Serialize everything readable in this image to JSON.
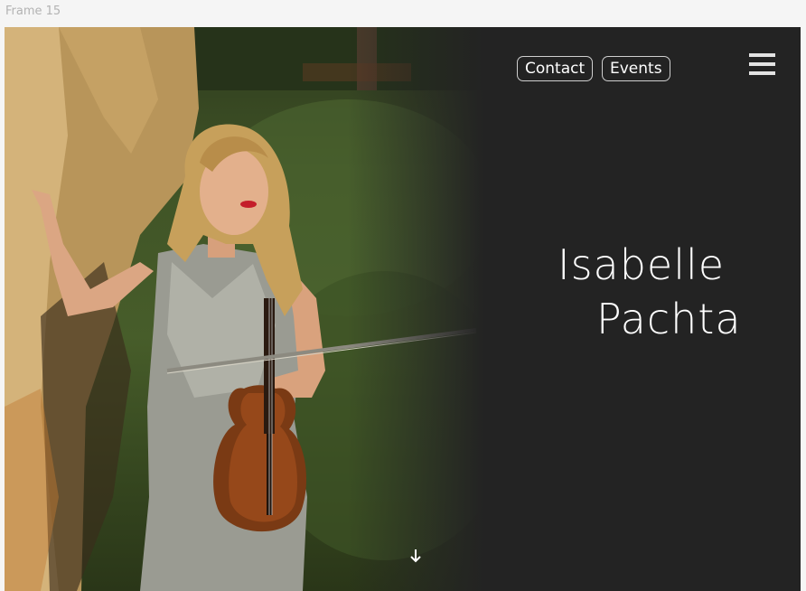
{
  "frame": {
    "label": "Frame 15"
  },
  "nav": {
    "contact_label": "Contact",
    "events_label": "Events",
    "menu_icon": "hamburger-menu-icon"
  },
  "hero": {
    "first_name": "Isabelle",
    "last_name": "Pachta",
    "photo_subject": "violinist-portrait-photo",
    "scroll_icon": "arrow-down-icon"
  },
  "colors": {
    "panel_background": "#232323",
    "text": "#ffffff",
    "pill_border": "#cfcfcf",
    "page_background": "#f5f5f5"
  }
}
